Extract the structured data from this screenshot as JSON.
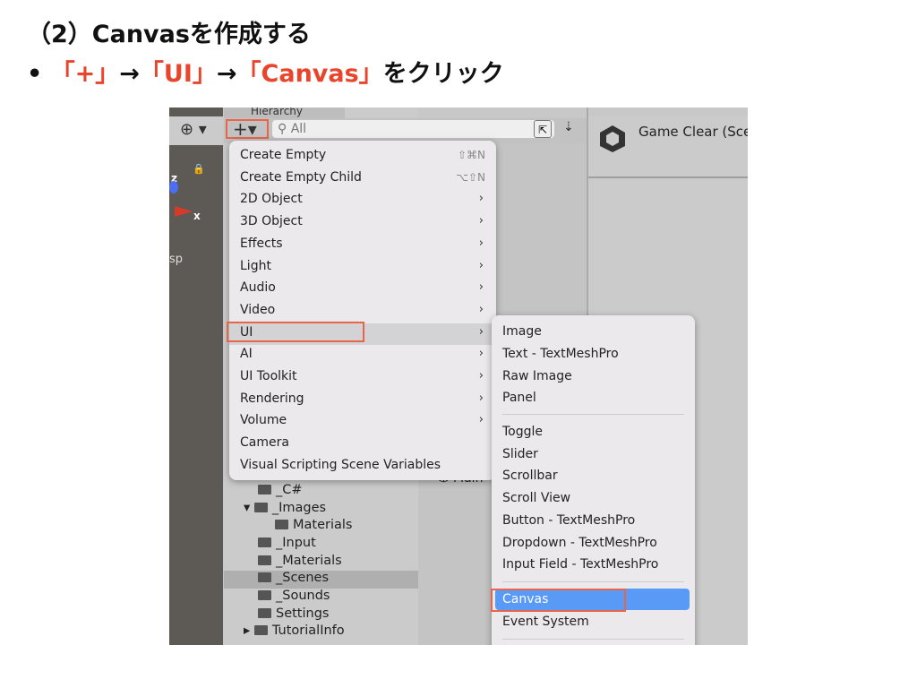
{
  "heading": "（2）Canvasを作成する",
  "bullet": {
    "mark": "•",
    "part1": "「+」",
    "arrow1": "→",
    "part2": "「UI」",
    "arrow2": "→",
    "part3": "「Canvas」",
    "tail": "をクリック"
  },
  "hierarchy": {
    "tab": "Hierarchy",
    "plus": "+▾",
    "search_placeholder": "All"
  },
  "inspector": {
    "title": "Game Clear (Scene)"
  },
  "scene": {
    "axis_z": "z",
    "axis_x": "x",
    "label": "sp"
  },
  "main_label": "Main",
  "menu": [
    {
      "label": "Create Empty",
      "shortcut": "⇧⌘N"
    },
    {
      "label": "Create Empty Child",
      "shortcut": "⌥⇧N"
    },
    {
      "label": "2D Object",
      "submenu": true
    },
    {
      "label": "3D Object",
      "submenu": true
    },
    {
      "label": "Effects",
      "submenu": true
    },
    {
      "label": "Light",
      "submenu": true
    },
    {
      "label": "Audio",
      "submenu": true
    },
    {
      "label": "Video",
      "submenu": true
    },
    {
      "label": "UI",
      "submenu": true
    },
    {
      "label": "AI",
      "submenu": true
    },
    {
      "label": "UI Toolkit",
      "submenu": true
    },
    {
      "label": "Rendering",
      "submenu": true
    },
    {
      "label": "Volume",
      "submenu": true
    },
    {
      "label": "Camera"
    },
    {
      "label": "Visual Scripting Scene Variables"
    }
  ],
  "submenu": [
    "Image",
    "Text - TextMeshPro",
    "Raw Image",
    "Panel",
    "Toggle",
    "Slider",
    "Scrollbar",
    "Scroll View",
    "Button - TextMeshPro",
    "Dropdown - TextMeshPro",
    "Input Field - TextMeshPro",
    "Canvas",
    "Event System"
  ],
  "project": [
    "_C#",
    "_Images",
    "Materials",
    "_Input",
    "_Materials",
    "_Scenes",
    "_Sounds",
    "Settings",
    "TutorialInfo"
  ],
  "colors": {
    "highlight": "#e8654a",
    "selected": "#5a9af7",
    "accent_text": "#e8452c"
  }
}
